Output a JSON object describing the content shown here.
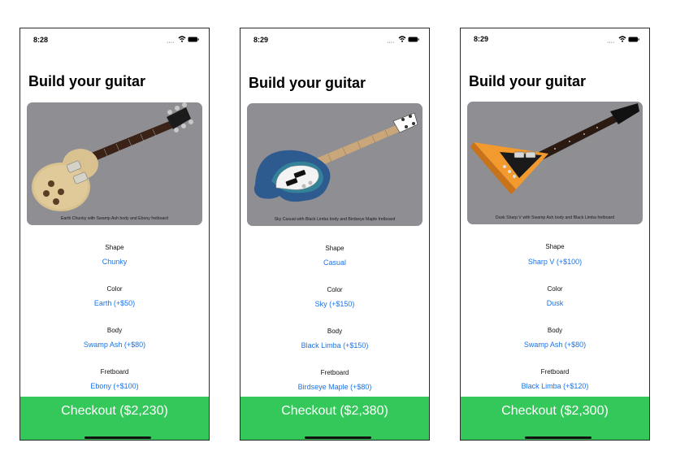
{
  "screens": [
    {
      "time": "8:28",
      "title": "Build your guitar",
      "caption": "Earth Chunky with Swamp Ash body and Ebony fretboard",
      "image_icon": "les-paul-guitar",
      "options": [
        {
          "label": "Shape",
          "value": "Chunky"
        },
        {
          "label": "Color",
          "value": "Earth (+$50)"
        },
        {
          "label": "Body",
          "value": "Swamp Ash (+$80)"
        },
        {
          "label": "Fretboard",
          "value": "Ebony (+$100)"
        }
      ],
      "checkout": "Checkout ($2,230)"
    },
    {
      "time": "8:29",
      "title": "Build your guitar",
      "caption": "Sky Casual with Black Limba body and Birdseye Maple fretboard",
      "image_icon": "bass-guitar",
      "options": [
        {
          "label": "Shape",
          "value": "Casual"
        },
        {
          "label": "Color",
          "value": "Sky (+$150)"
        },
        {
          "label": "Body",
          "value": "Black Limba (+$150)"
        },
        {
          "label": "Fretboard",
          "value": "Birdseye Maple (+$80)"
        }
      ],
      "checkout": "Checkout ($2,380)"
    },
    {
      "time": "8:29",
      "title": "Build your guitar",
      "caption": "Dusk Sharp V with Swamp Ash body and Black Limba fretboard",
      "image_icon": "flying-v-guitar",
      "options": [
        {
          "label": "Shape",
          "value": "Sharp V (+$100)"
        },
        {
          "label": "Color",
          "value": "Dusk"
        },
        {
          "label": "Body",
          "value": "Swamp Ash (+$80)"
        },
        {
          "label": "Fretboard",
          "value": "Black Limba (+$120)"
        }
      ],
      "checkout": "Checkout ($2,300)"
    }
  ],
  "colors": {
    "accent": "#1a73e8",
    "checkout": "#34c759",
    "image_bg": "#8e8e93"
  },
  "icons": [
    "ellipsis-signal-icon",
    "wifi-icon",
    "battery-icon"
  ]
}
